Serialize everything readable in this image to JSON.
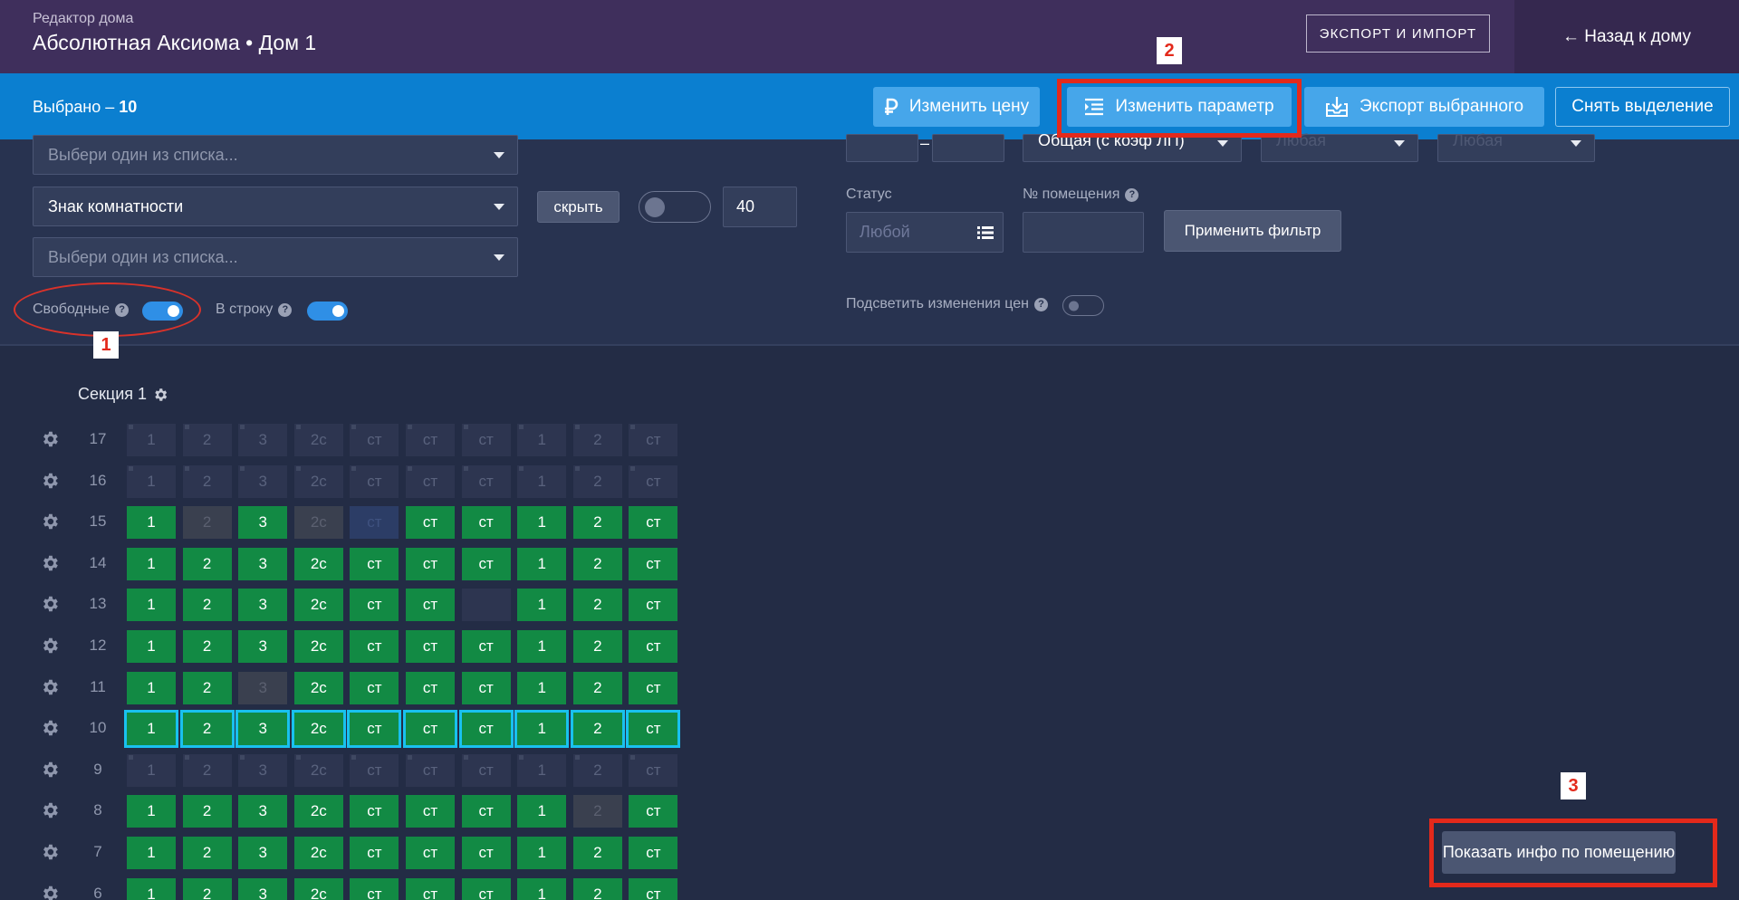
{
  "header": {
    "subtitle": "Редактор дома",
    "title": "Абсолютная Аксиома • Дом 1",
    "export_import_label": "ЭКСПОРТ И ИМПОРТ",
    "back_label": "← Назад к дому"
  },
  "selection_bar": {
    "selected_prefix": "Выбрано – ",
    "selected_count": "10",
    "buttons": {
      "change_price": "Изменить цену",
      "change_param": "Изменить параметр",
      "export_selected": "Экспорт выбранного",
      "clear_selection": "Снять выделение"
    }
  },
  "filters": {
    "select_top_placeholder": "Выбери один из списка...",
    "select_room_sign": "Знак комнатности",
    "select_bottom_placeholder": "Выбери один из списка...",
    "hide_button": "скрыть",
    "count_value": "40",
    "free_label": "Свободные",
    "inline_label": "В строку",
    "area_type_value": "Общая (с коэф ЛП)",
    "any_1": "Любая",
    "any_2": "Любая",
    "status_label": "Статус",
    "status_placeholder": "Любой",
    "room_number_label": "№ помещения",
    "apply_filter": "Применить фильтр",
    "highlight_price_label": "Подсветить изменения цен",
    "range_dash": "–"
  },
  "annotations": {
    "badge_1": "1",
    "badge_2": "2",
    "badge_3": "3"
  },
  "section": {
    "title": "Секция 1"
  },
  "apartment_types": [
    "1",
    "2",
    "3",
    "2с",
    "ст",
    "ст",
    "ст",
    "1",
    "2",
    "ст"
  ],
  "floors": [
    {
      "num": "17",
      "states": [
        "f",
        "f",
        "f",
        "f",
        "f",
        "f",
        "f",
        "f",
        "f",
        "f"
      ]
    },
    {
      "num": "16",
      "states": [
        "f",
        "f",
        "f",
        "f",
        "f",
        "f",
        "f",
        "f",
        "f",
        "f"
      ]
    },
    {
      "num": "15",
      "states": [
        "g",
        "x",
        "g",
        "x",
        "b",
        "g",
        "g",
        "g",
        "g",
        "g"
      ]
    },
    {
      "num": "14",
      "states": [
        "g",
        "g",
        "g",
        "g",
        "g",
        "g",
        "g",
        "g",
        "g",
        "g"
      ]
    },
    {
      "num": "13",
      "states": [
        "g",
        "g",
        "g",
        "g",
        "g",
        "g",
        "e",
        "g",
        "g",
        "g"
      ]
    },
    {
      "num": "12",
      "states": [
        "g",
        "g",
        "g",
        "g",
        "g",
        "g",
        "g",
        "g",
        "g",
        "g"
      ]
    },
    {
      "num": "11",
      "states": [
        "g",
        "g",
        "x",
        "g",
        "g",
        "g",
        "g",
        "g",
        "g",
        "g"
      ]
    },
    {
      "num": "10",
      "states": [
        "s",
        "s",
        "s",
        "s",
        "s",
        "s",
        "s",
        "s",
        "s",
        "s"
      ]
    },
    {
      "num": "9",
      "states": [
        "f",
        "f",
        "f",
        "f",
        "f",
        "f",
        "f",
        "f",
        "f",
        "f"
      ]
    },
    {
      "num": "8",
      "states": [
        "g",
        "g",
        "g",
        "g",
        "g",
        "g",
        "g",
        "g",
        "x",
        "g"
      ]
    },
    {
      "num": "7",
      "states": [
        "g",
        "g",
        "g",
        "g",
        "g",
        "g",
        "g",
        "g",
        "g",
        "g"
      ]
    },
    {
      "num": "6",
      "states": [
        "g",
        "g",
        "g",
        "g",
        "g",
        "g",
        "g",
        "g",
        "g",
        "g"
      ]
    }
  ],
  "info_button": "Показать инфо по помещению",
  "colors": {
    "header": "#3f2f5c",
    "selection_bar": "#0b7fd0",
    "free_cell": "#128a44",
    "selected_outline": "#19c1ef",
    "annotation": "#e3291b"
  }
}
